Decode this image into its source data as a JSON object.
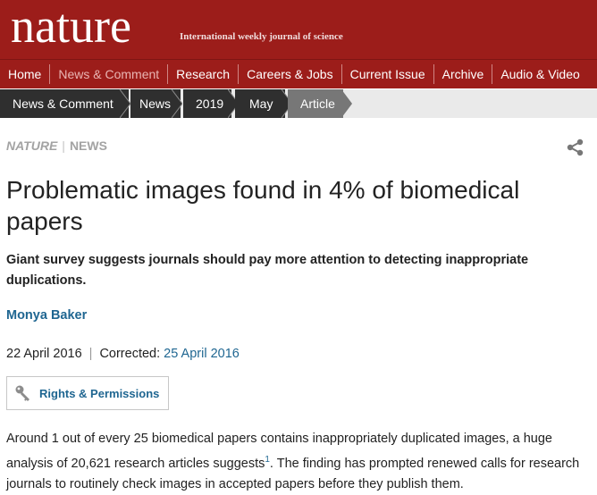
{
  "brand": {
    "logo_text": "nature",
    "tagline": "International weekly journal of science"
  },
  "main_nav": {
    "items": [
      {
        "label": "Home",
        "active": false
      },
      {
        "label": "News & Comment",
        "active": true
      },
      {
        "label": "Research",
        "active": false
      },
      {
        "label": "Careers & Jobs",
        "active": false
      },
      {
        "label": "Current Issue",
        "active": false
      },
      {
        "label": "Archive",
        "active": false
      },
      {
        "label": "Audio & Video",
        "active": false
      }
    ]
  },
  "breadcrumb": {
    "items": [
      "News & Comment",
      "News",
      "2019",
      "May",
      "Article"
    ]
  },
  "article": {
    "kicker_journal": "NATURE",
    "kicker_section": "NEWS",
    "kicker_separator": "|",
    "title": "Problematic images found in 4% of biomedical papers",
    "standfirst": "Giant survey suggests journals should pay more attention to detecting inappropriate duplications.",
    "author": "Monya Baker",
    "published_date": "22 April 2016",
    "corrected_label": "Corrected:",
    "corrected_date": "25 April 2016",
    "rights_label": "Rights & Permissions",
    "body_part1": "Around 1 out of every 25 biomedical papers contains inappropriately duplicated images, a huge analysis of 20,621 research articles suggests",
    "body_ref": "1",
    "body_part2": ". The finding has prompted renewed calls for research journals to routinely check images in accepted papers before they publish them."
  },
  "colors": {
    "brand_red": "#9c1d1a",
    "breadcrumb_dark": "#2f2f2f",
    "breadcrumb_active": "#777777",
    "link_blue": "#1f6691"
  },
  "icons": {
    "share": "share-icon",
    "rights": "key-icon"
  }
}
